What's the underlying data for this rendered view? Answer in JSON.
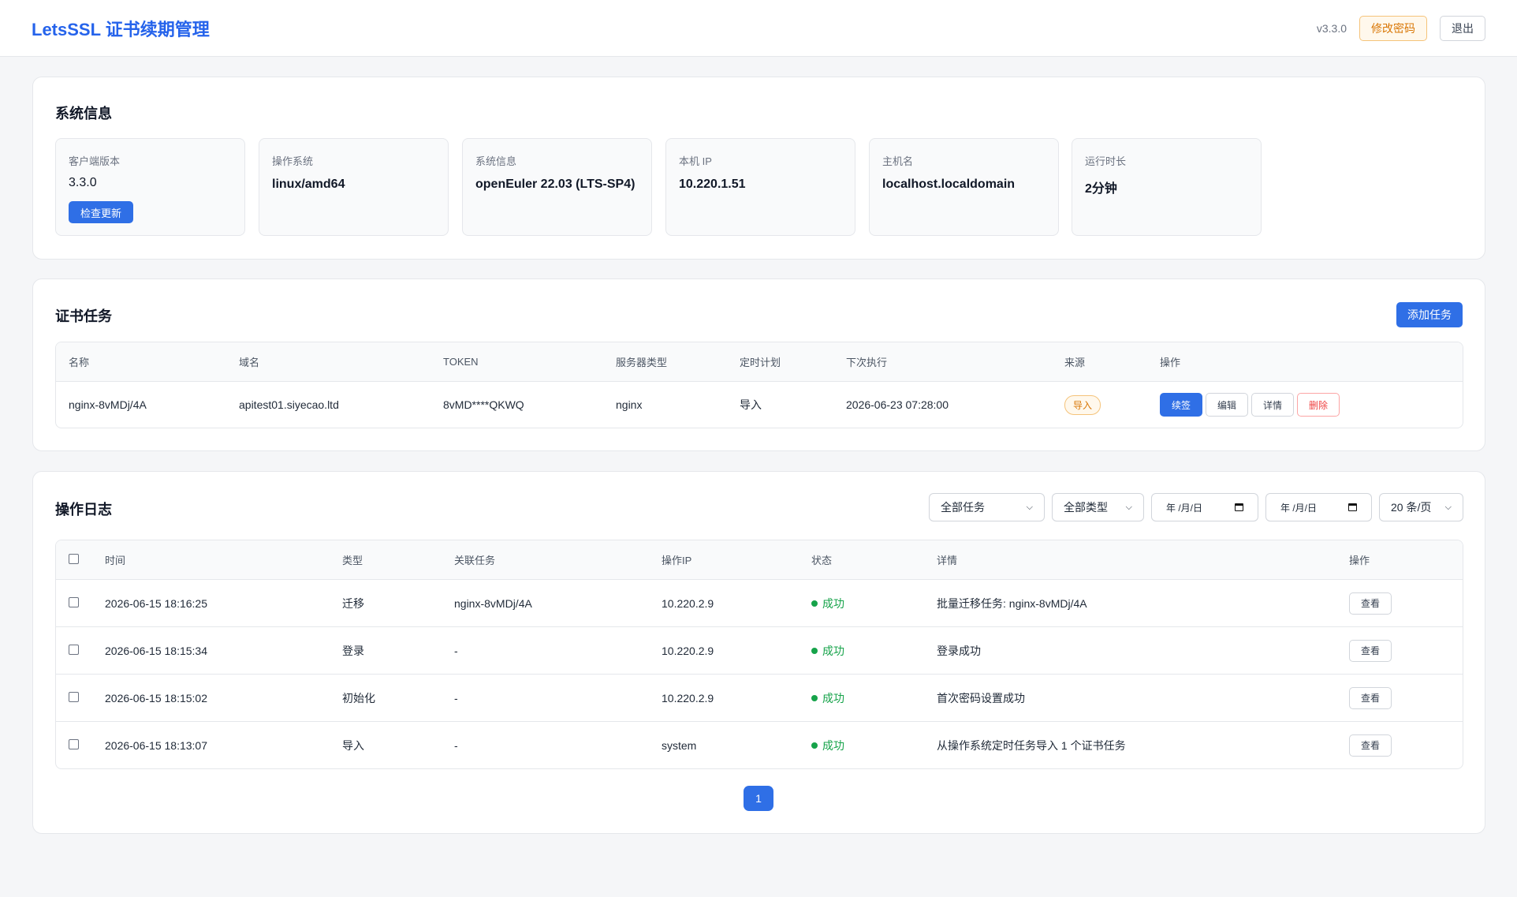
{
  "header": {
    "brand": "LetsSSL 证书续期管理",
    "version": "v3.3.0",
    "change_password": "修改密码",
    "logout": "退出"
  },
  "system_info": {
    "title": "系统信息",
    "items": [
      {
        "label": "客户端版本",
        "value": "3.3.0"
      },
      {
        "label": "操作系统",
        "value": "linux/amd64"
      },
      {
        "label": "系统信息",
        "value": "openEuler 22.03 (LTS-SP4)"
      },
      {
        "label": "本机 IP",
        "value": "10.220.1.51"
      },
      {
        "label": "主机名",
        "value": "localhost.localdomain"
      },
      {
        "label": "运行时长",
        "value": "2分钟"
      }
    ],
    "check_update": "检查更新"
  },
  "tasks": {
    "title": "证书任务",
    "add_button": "添加任务",
    "columns": [
      "名称",
      "域名",
      "TOKEN",
      "服务器类型",
      "定时计划",
      "下次执行",
      "来源",
      "操作"
    ],
    "rows": [
      {
        "name": "nginx-8vMDj/4A",
        "domain": "apitest01.siyecao.ltd",
        "token": "8vMD****QKWQ",
        "server_type": "nginx",
        "schedule": "导入",
        "next_run": "2026-06-23 07:28:00",
        "source": "导入",
        "actions": {
          "renew": "续签",
          "edit": "编辑",
          "detail": "详情",
          "delete": "删除"
        }
      }
    ]
  },
  "logs": {
    "title": "操作日志",
    "filters": {
      "task": "全部任务",
      "type": "全部类型",
      "date_from": "年 /月/日",
      "date_to": "年 /月/日",
      "page_size": "20 条/页"
    },
    "columns": [
      "时间",
      "类型",
      "关联任务",
      "操作IP",
      "状态",
      "详情",
      "操作"
    ],
    "rows": [
      {
        "time": "2026-06-15 18:16:25",
        "type": "迁移",
        "task": "nginx-8vMDj/4A",
        "ip": "10.220.2.9",
        "status": "成功",
        "detail": "批量迁移任务: nginx-8vMDj/4A",
        "action": "查看"
      },
      {
        "time": "2026-06-15 18:15:34",
        "type": "登录",
        "task": "-",
        "ip": "10.220.2.9",
        "status": "成功",
        "detail": "登录成功",
        "action": "查看"
      },
      {
        "time": "2026-06-15 18:15:02",
        "type": "初始化",
        "task": "-",
        "ip": "10.220.2.9",
        "status": "成功",
        "detail": "首次密码设置成功",
        "action": "查看"
      },
      {
        "time": "2026-06-15 18:13:07",
        "type": "导入",
        "task": "-",
        "ip": "system",
        "status": "成功",
        "detail": "从操作系统定时任务导入 1 个证书任务",
        "action": "查看"
      }
    ],
    "current_page": "1"
  },
  "colors": {
    "brand": "#2563eb",
    "primary": "#2f6fe6",
    "success": "#16a34a",
    "warning": "#d97706",
    "danger": "#ef4444"
  }
}
